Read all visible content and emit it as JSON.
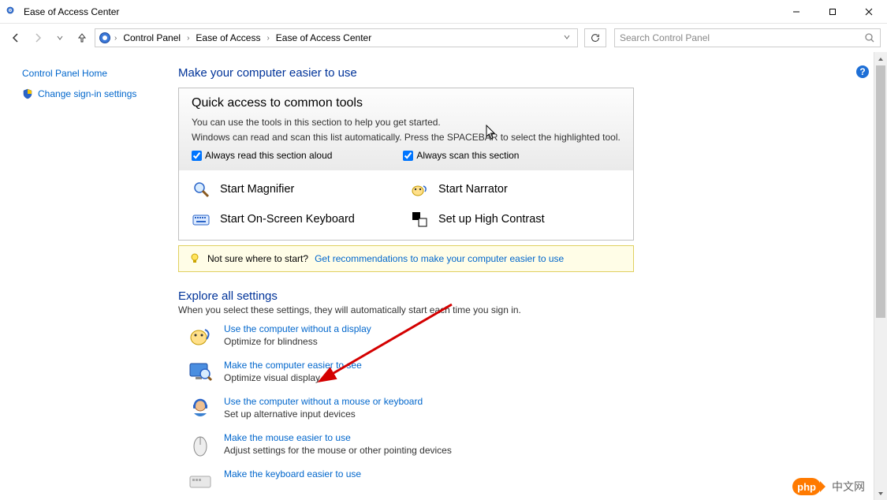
{
  "window": {
    "title": "Ease of Access Center"
  },
  "breadcrumbs": {
    "b0": "Control Panel",
    "b1": "Ease of Access",
    "b2": "Ease of Access Center"
  },
  "search": {
    "placeholder": "Search Control Panel"
  },
  "sidebar": {
    "home": "Control Panel Home",
    "signin": "Change sign-in settings"
  },
  "main": {
    "heading": "Make your computer easier to use",
    "quick": {
      "title": "Quick access to common tools",
      "desc1": "You can use the tools in this section to help you get started.",
      "desc2": "Windows can read and scan this list automatically.  Press the SPACEBAR to select the highlighted tool.",
      "chk1": "Always read this section aloud",
      "chk2": "Always scan this section",
      "items": {
        "magnifier": "Start Magnifier",
        "osk": "Start On-Screen Keyboard",
        "narrator": "Start Narrator",
        "contrast": "Set up High Contrast"
      }
    },
    "hint": {
      "q": "Not sure where to start?",
      "link": "Get recommendations to make your computer easier to use"
    },
    "explore": {
      "title": "Explore all settings",
      "sub": "When you select these settings, they will automatically start each time you sign in.",
      "items": [
        {
          "link": "Use the computer without a display",
          "desc": "Optimize for blindness"
        },
        {
          "link": "Make the computer easier to see",
          "desc": "Optimize visual display"
        },
        {
          "link": "Use the computer without a mouse or keyboard",
          "desc": "Set up alternative input devices"
        },
        {
          "link": "Make the mouse easier to use",
          "desc": "Adjust settings for the mouse or other pointing devices"
        },
        {
          "link": "Make the keyboard easier to use",
          "desc": ""
        }
      ]
    }
  },
  "watermark": {
    "pill": "php",
    "text": "中文网"
  }
}
